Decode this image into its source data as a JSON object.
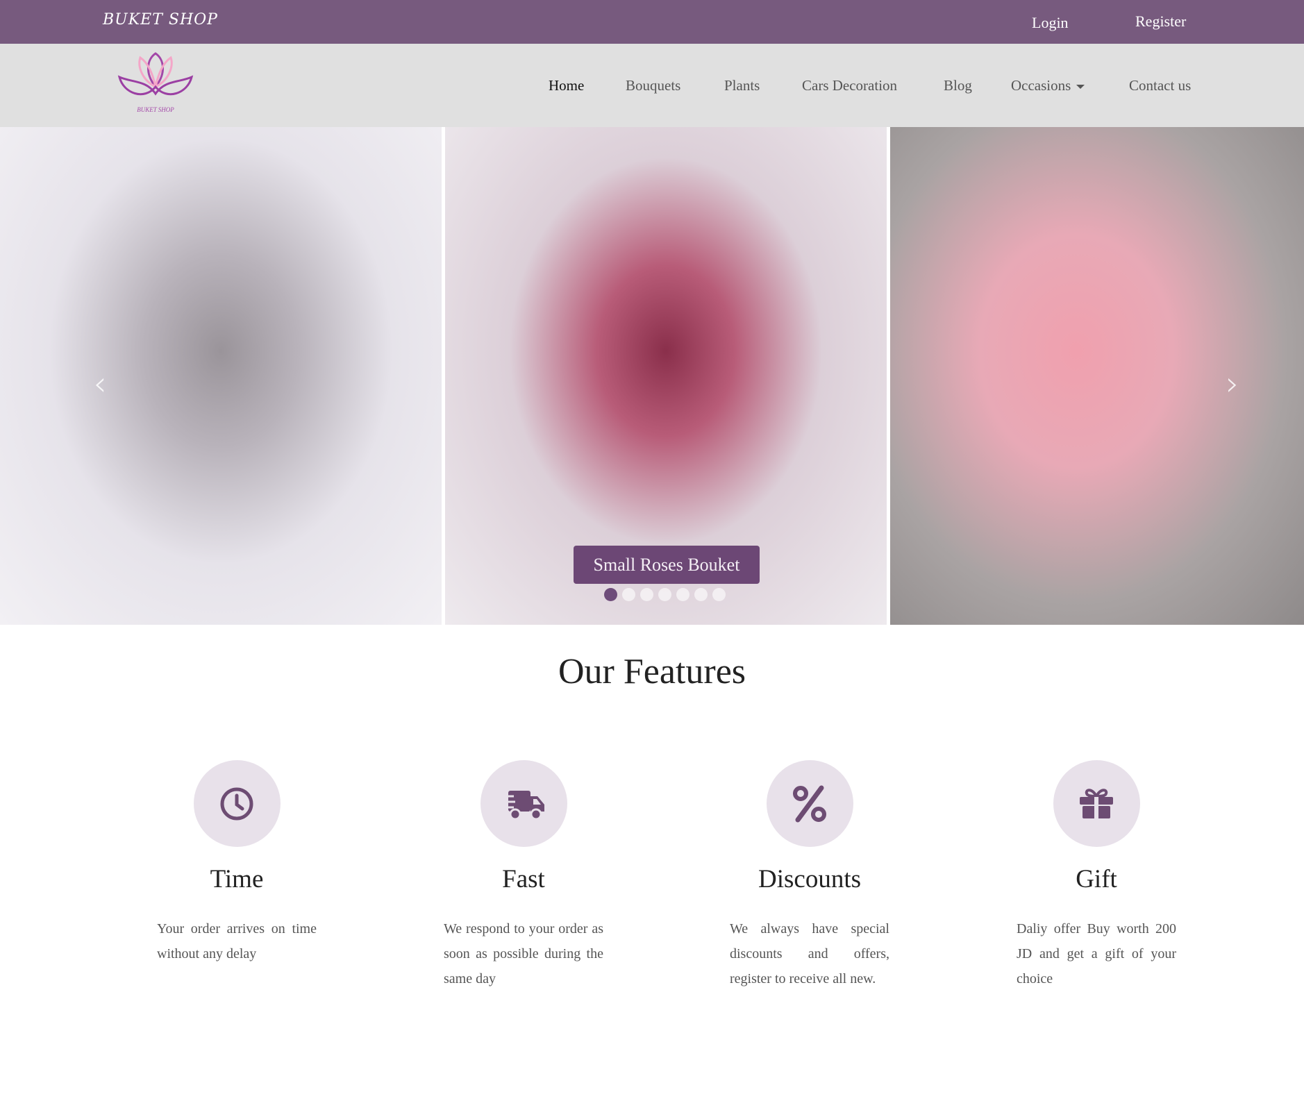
{
  "topbar": {
    "brand": "BUKET SHOP",
    "login": "Login",
    "register": "Register"
  },
  "colors": {
    "primary": "#775a7e",
    "navbar_bg": "#e0e0e0",
    "icon": "#6d4c73",
    "icon_bg": "#e8e1ea"
  },
  "nav": {
    "logo_text": "BUKET SHOP",
    "items": [
      "Home",
      "Bouquets",
      "Plants",
      "Cars Decoration",
      "Blog",
      "Occasions",
      "Contact us"
    ],
    "active": "Home"
  },
  "carousel": {
    "caption": "Small Roses Bouket",
    "slide_count": 7,
    "active_index": 0
  },
  "features": {
    "heading": "Our Features",
    "items": [
      {
        "icon": "clock-icon",
        "title": "Time",
        "text": "Your order arrives on time without any delay"
      },
      {
        "icon": "truck-fast-icon",
        "title": "Fast",
        "text": "We respond to your order as soon as possible during the same day"
      },
      {
        "icon": "percent-icon",
        "title": "Discounts",
        "text": "We always have special discounts and offers, register to receive all new."
      },
      {
        "icon": "gift-icon",
        "title": "Gift",
        "text": "Daliy offer Buy worth 200 JD and get a gift of your choice"
      }
    ]
  }
}
